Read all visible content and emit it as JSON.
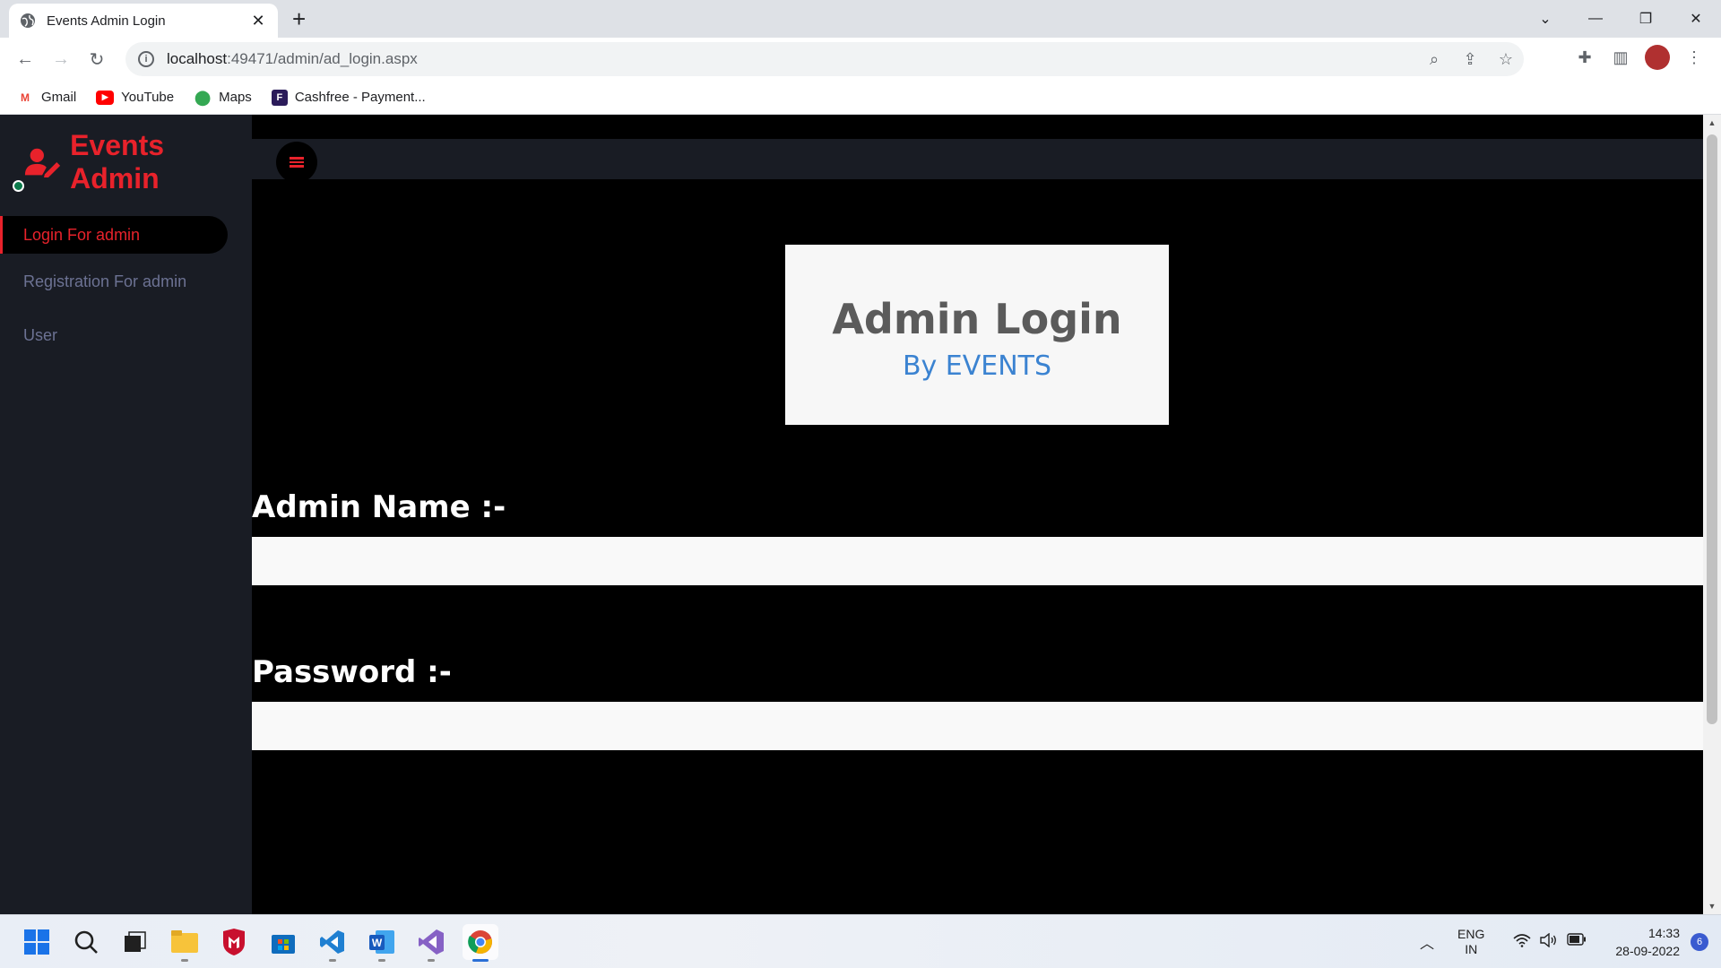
{
  "browser": {
    "tab_title": "Events Admin Login",
    "url_host": "localhost",
    "url_path": ":49471/admin/ad_login.aspx",
    "bookmarks": [
      {
        "label": "Gmail"
      },
      {
        "label": "YouTube"
      },
      {
        "label": "Maps"
      },
      {
        "label": "Cashfree - Payment..."
      }
    ]
  },
  "sidebar": {
    "brand": "Events Admin",
    "items": [
      {
        "label": "Login For admin",
        "active": true
      },
      {
        "label": "Registration For admin",
        "active": false
      },
      {
        "label": "User",
        "active": false
      }
    ]
  },
  "main": {
    "card_title": "Admin Login",
    "card_subtitle": "By EVENTS",
    "admin_name_label": "Admin Name :-",
    "password_label": "Password :-",
    "admin_name_value": "",
    "password_value": ""
  },
  "taskbar": {
    "language": "ENG",
    "region": "IN",
    "time": "14:33",
    "date": "28-09-2022",
    "notifications": "6"
  },
  "colors": {
    "accent": "#e8222b",
    "sidebar_bg": "#191c24",
    "subtitle": "#3b83d1"
  }
}
